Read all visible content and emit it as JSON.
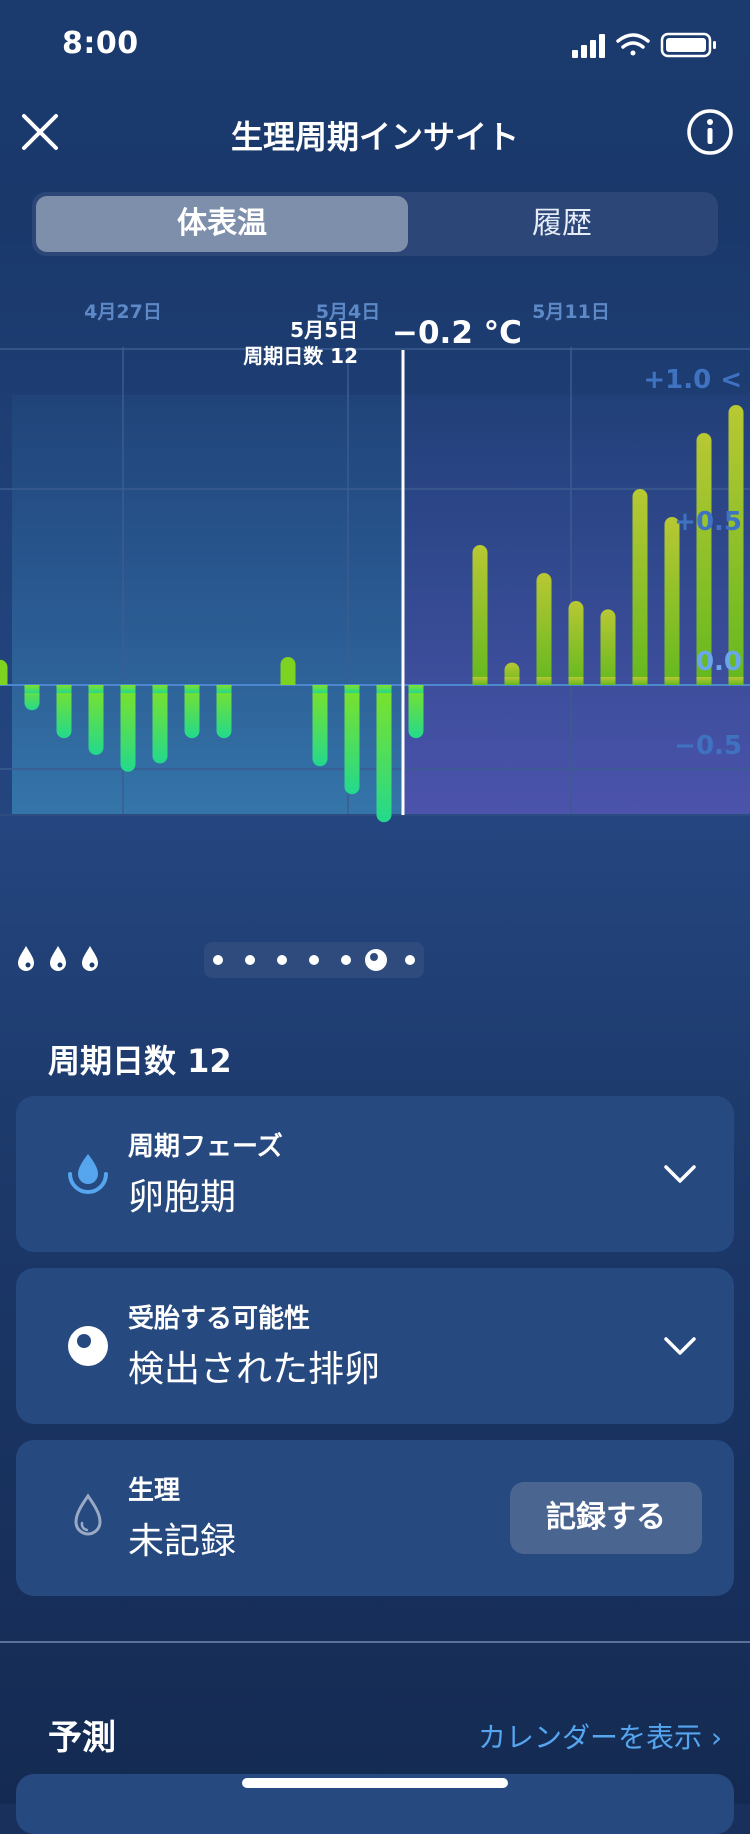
{
  "status_bar": {
    "time": "8:00"
  },
  "header": {
    "title": "生理周期インサイト",
    "close_icon": "close-icon",
    "info_icon": "info-icon"
  },
  "segments": {
    "selected": "体表温",
    "other": "履歴"
  },
  "chart_data": {
    "type": "bar",
    "x_labels": [
      "4月27日",
      "5月4日",
      "5月11日"
    ],
    "y_ticks": [
      "+1.0 <",
      "+0.5",
      "0.0",
      "−0.5"
    ],
    "ylim": [
      -0.9,
      1.1
    ],
    "selected_index": 12,
    "selected_date": "5月5日",
    "selected_cycle_day": "周期日数 12",
    "selected_value_label": "−0.2 °C",
    "values": [
      0.09,
      -0.09,
      -0.19,
      -0.25,
      -0.31,
      -0.28,
      -0.19,
      -0.19,
      0.0,
      0.1,
      -0.29,
      -0.39,
      -0.49,
      -0.19,
      0.0,
      0.5,
      0.08,
      0.4,
      0.3,
      0.27,
      0.7,
      0.6,
      0.9,
      1.0
    ],
    "grid": true
  },
  "phase_icons": [
    "drop-icon",
    "drop-icon",
    "drop-icon"
  ],
  "pager": {
    "count": 7,
    "active_index": 5
  },
  "cycle_day_title": "周期日数 12",
  "cards": [
    {
      "label": "周期フェーズ",
      "value": "卵胞期",
      "icon": "phase-drop-icon"
    },
    {
      "label": "受胎する可能性",
      "value": "検出された排卵",
      "icon": "ovulation-icon"
    },
    {
      "label": "生理",
      "value": "未記録",
      "icon": "period-drop-icon",
      "button": "記録する"
    }
  ],
  "prediction": {
    "title": "予測",
    "link": "カレンダーを表示 ›"
  },
  "colors": {
    "accent_link": "#55a6ee",
    "bar_green": "#7ed321",
    "bar_neg": "#37e07a"
  }
}
